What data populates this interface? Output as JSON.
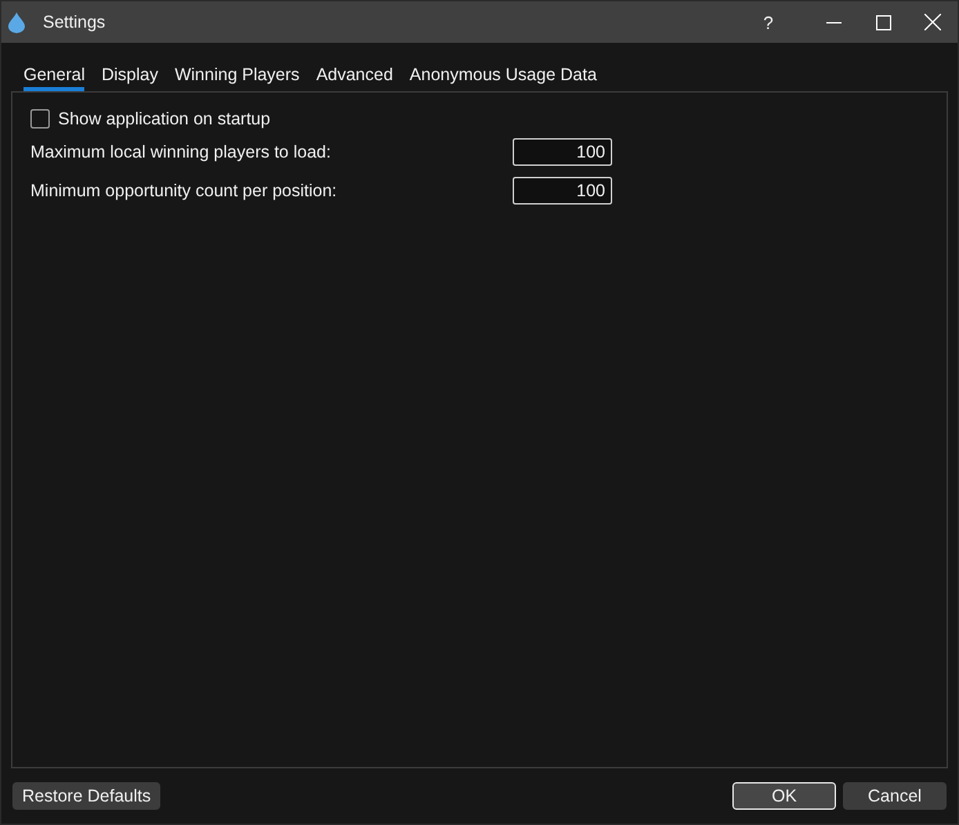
{
  "window": {
    "title": "Settings",
    "help": "?"
  },
  "tabs": [
    {
      "label": "General",
      "selected": true
    },
    {
      "label": "Display",
      "selected": false
    },
    {
      "label": "Winning Players",
      "selected": false
    },
    {
      "label": "Advanced",
      "selected": false
    },
    {
      "label": "Anonymous Usage Data",
      "selected": false
    }
  ],
  "show_on_startup": {
    "label": "Show application on startup",
    "checked": false
  },
  "fields": [
    {
      "label": "Maximum local winning players to load:",
      "value": "100"
    },
    {
      "label": "Minimum opportunity count per position:",
      "value": "100"
    }
  ],
  "buttons": {
    "restore": "Restore Defaults",
    "ok": "OK",
    "cancel": "Cancel"
  }
}
